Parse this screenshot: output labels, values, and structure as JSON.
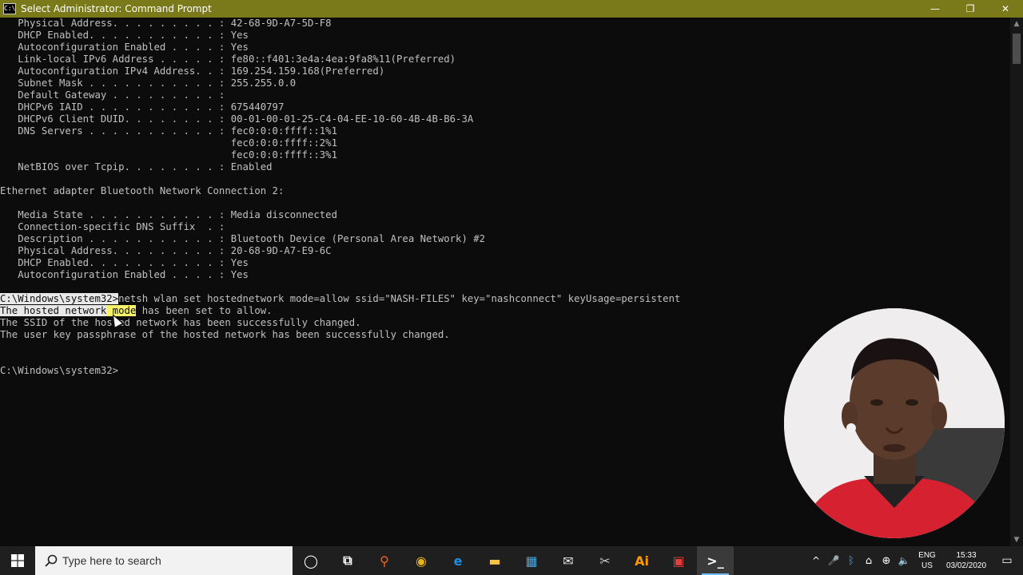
{
  "window": {
    "title": "Select Administrator: Command Prompt",
    "app_icon_text": "C:\\",
    "min": "—",
    "max": "❐",
    "close": "✕"
  },
  "console": {
    "lines": [
      "   Physical Address. . . . . . . . . : 42-68-9D-A7-5D-F8",
      "   DHCP Enabled. . . . . . . . . . . : Yes",
      "   Autoconfiguration Enabled . . . . : Yes",
      "   Link-local IPv6 Address . . . . . : fe80::f401:3e4a:4ea:9fa8%11(Preferred)",
      "   Autoconfiguration IPv4 Address. . : 169.254.159.168(Preferred)",
      "   Subnet Mask . . . . . . . . . . . : 255.255.0.0",
      "   Default Gateway . . . . . . . . . :",
      "   DHCPv6 IAID . . . . . . . . . . . : 675440797",
      "   DHCPv6 Client DUID. . . . . . . . : 00-01-00-01-25-C4-04-EE-10-60-4B-4B-B6-3A",
      "   DNS Servers . . . . . . . . . . . : fec0:0:0:ffff::1%1",
      "                                       fec0:0:0:ffff::2%1",
      "                                       fec0:0:0:ffff::3%1",
      "   NetBIOS over Tcpip. . . . . . . . : Enabled",
      "",
      "Ethernet adapter Bluetooth Network Connection 2:",
      "",
      "   Media State . . . . . . . . . . . : Media disconnected",
      "   Connection-specific DNS Suffix  . :",
      "   Description . . . . . . . . . . . : Bluetooth Device (Personal Area Network) #2",
      "   Physical Address. . . . . . . . . : 20-68-9D-A7-E9-6C",
      "   DHCP Enabled. . . . . . . . . . . : Yes",
      "   Autoconfiguration Enabled . . . . : Yes",
      ""
    ],
    "cmd_prompt": "C:\\Windows\\system32>",
    "cmd_text": "netsh wlan set hostednetwork mode=allow ssid=\"NASH-FILES\" key=\"nashconnect\" keyUsage=persistent",
    "result1_selected": "The hosted network",
    "result1_highlight": " mode",
    "result1_rest": " has been set to allow.",
    "result2": "The SSID of the hosted network has been successfully changed.",
    "result3": "The user key passphrase of the hosted network has been successfully changed.",
    "final_prompt": "C:\\Windows\\system32>"
  },
  "taskbar": {
    "search_placeholder": "Type here to search",
    "apps": [
      {
        "name": "cortana-icon",
        "glyph": "◯",
        "color": "#ffffff"
      },
      {
        "name": "task-view-icon",
        "glyph": "⧉",
        "color": "#ffffff"
      },
      {
        "name": "search-app-icon",
        "glyph": "⚲",
        "color": "#f0651f"
      },
      {
        "name": "chrome-icon",
        "glyph": "◉",
        "color": "#e8b417"
      },
      {
        "name": "edge-icon",
        "glyph": "e",
        "color": "#1e8fe0"
      },
      {
        "name": "file-explorer-icon",
        "glyph": "▬",
        "color": "#f6c343"
      },
      {
        "name": "store-icon",
        "glyph": "▦",
        "color": "#4ea6dc"
      },
      {
        "name": "mail-icon",
        "glyph": "✉",
        "color": "#e8e8e8"
      },
      {
        "name": "snipping-tool-icon",
        "glyph": "✂",
        "color": "#c9c9c9"
      },
      {
        "name": "illustrator-icon",
        "glyph": "Ai",
        "color": "#ff9a00"
      },
      {
        "name": "photos-icon",
        "glyph": "▣",
        "color": "#e33d3d"
      },
      {
        "name": "command-prompt-icon",
        "glyph": ">_",
        "color": "#ffffff"
      }
    ],
    "tray": {
      "chevron": "^",
      "mic": "🎤",
      "bluetooth": "ᛒ",
      "network": "⌂",
      "globe": "⊕",
      "volume": "🔈",
      "lang_top": "ENG",
      "lang_bottom": "US",
      "time": "15:33",
      "date": "03/02/2020",
      "notification": "▭"
    }
  }
}
